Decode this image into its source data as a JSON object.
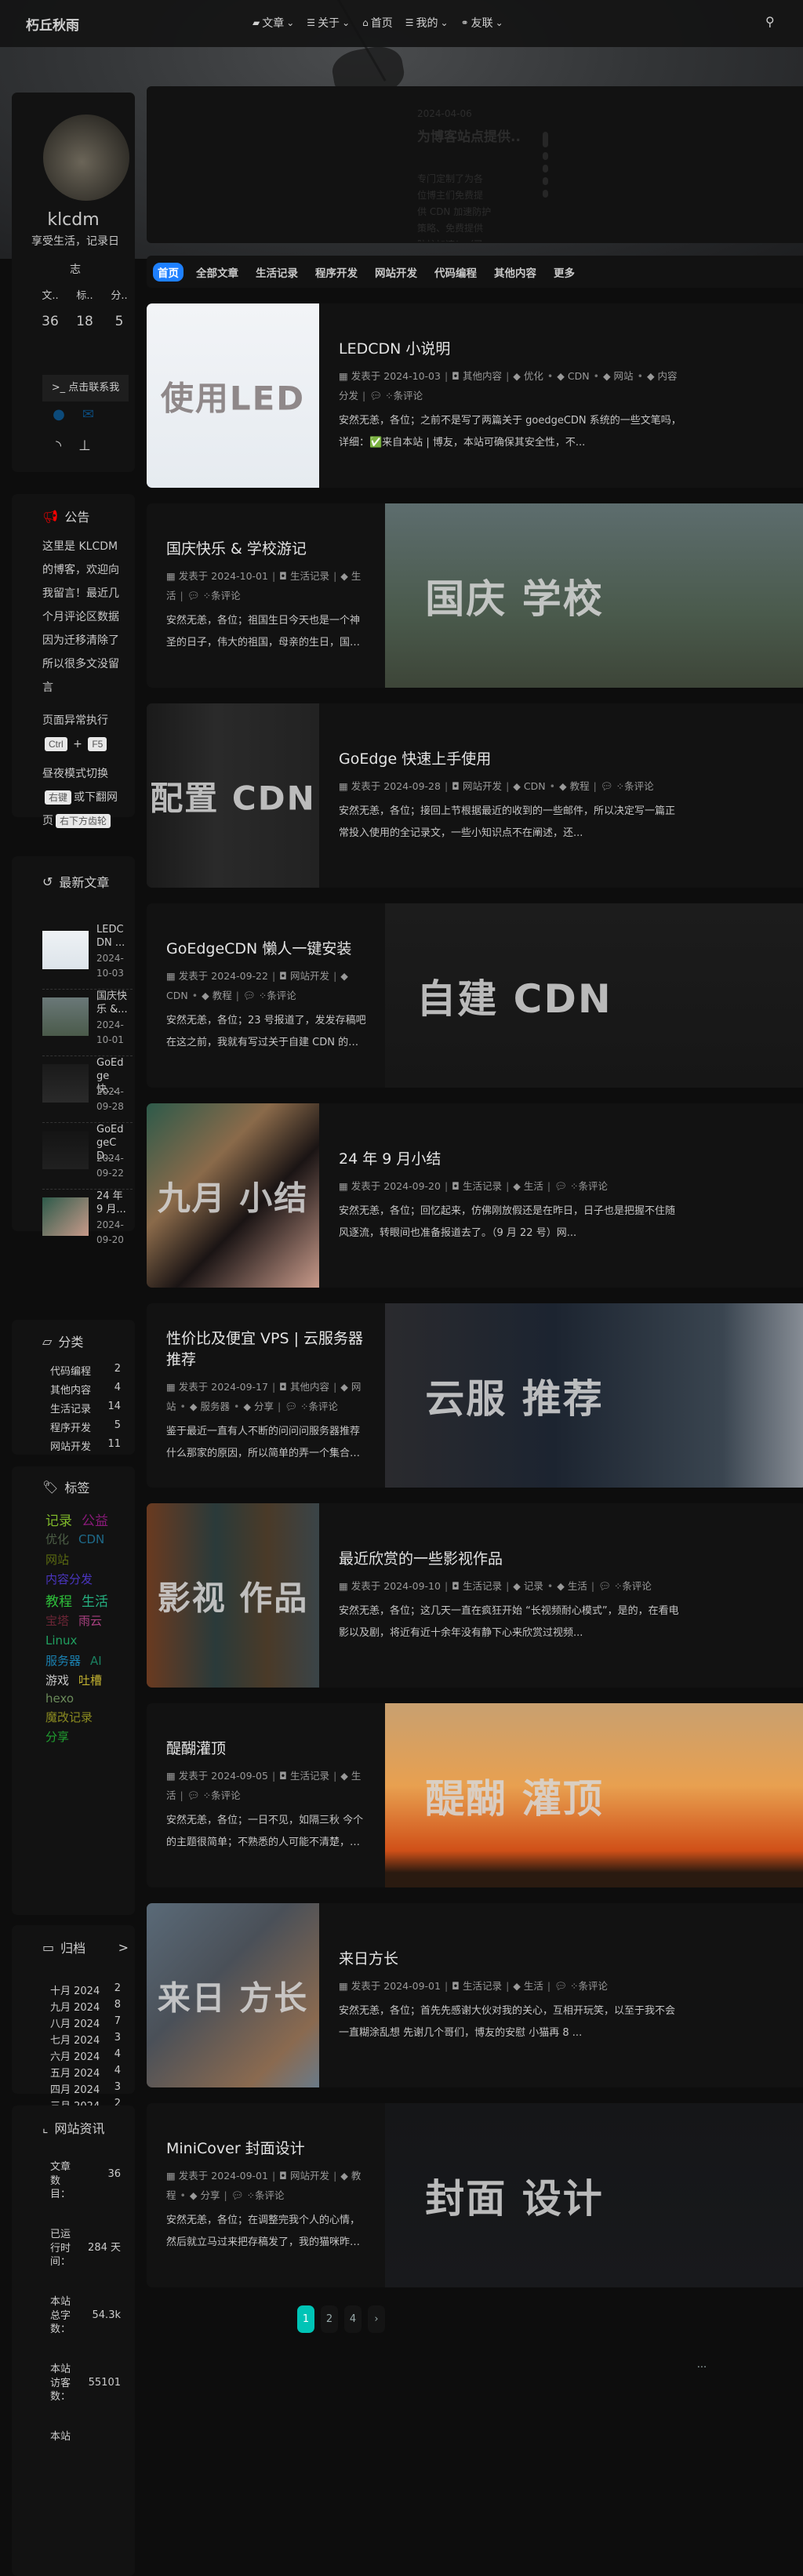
{
  "header": {
    "logo": "朽丘秋雨",
    "menu": [
      {
        "icon": "folder-icon",
        "glyph": "▰",
        "label": "文章",
        "dropdown": true
      },
      {
        "icon": "list-icon",
        "glyph": "☰",
        "label": "关于",
        "dropdown": true
      },
      {
        "icon": "home-icon",
        "glyph": "⌂",
        "label": "首页",
        "dropdown": false
      },
      {
        "icon": "list-icon",
        "glyph": "☰",
        "label": "我的",
        "dropdown": true
      },
      {
        "icon": "link-icon",
        "glyph": "⚭",
        "label": "友联",
        "dropdown": true
      }
    ],
    "search_icon": "search-icon"
  },
  "profile": {
    "name": "klcdm",
    "description": "享受生活，记录日志",
    "stats": [
      {
        "label": "文..",
        "value": "36"
      },
      {
        "label": "标..",
        "value": "18"
      },
      {
        "label": "分..",
        "value": "5"
      }
    ],
    "contact_button": "点击联系我",
    "social_color": "#0c4a7a"
  },
  "notice": {
    "title": "公告",
    "icon_color": "#ff0000",
    "text": "这里是 KLCDM 的博客，欢迎向我留言！最近几个月评论区数据因为迁移清除了所以很多文没留言",
    "refresh_label": "页面异常执行",
    "key1": "Ctrl",
    "plus": "+",
    "key2": "F5",
    "mode_label": "昼夜模式切换",
    "key3": "右键",
    "mode_mid": "或下翻网页",
    "key4": "右下方齿轮"
  },
  "latest": {
    "title": "最新文章",
    "items": [
      {
        "title": "LEDCDN ...",
        "date": "2024-10-03"
      },
      {
        "title": "国庆快乐 &...",
        "date": "2024-10-01"
      },
      {
        "title": "GoEdge 快...",
        "date": "2024-09-28"
      },
      {
        "title": "GoEdgeCD...",
        "date": "2024-09-22"
      },
      {
        "title": "24 年 9 月...",
        "date": "2024-09-20"
      }
    ]
  },
  "categories": {
    "title": "分类",
    "items": [
      {
        "name": "代码编程",
        "count": "2"
      },
      {
        "name": "其他内容",
        "count": "4"
      },
      {
        "name": "生活记录",
        "count": "14"
      },
      {
        "name": "程序开发",
        "count": "5"
      },
      {
        "name": "网站开发",
        "count": "11"
      }
    ]
  },
  "tags": {
    "title": "标签",
    "rows": [
      [
        {
          "name": "记录",
          "color": "#7fb82a"
        },
        {
          "name": "公益",
          "color": "#8a1a7a"
        }
      ],
      [
        {
          "name": "优化",
          "color": "#4c5e45"
        },
        {
          "name": "CDN",
          "color": "#1e6a8a"
        }
      ],
      [
        {
          "name": "网站",
          "color": "#5a6a10"
        }
      ],
      [
        {
          "name": "内容分发",
          "color": "#4a35c0"
        }
      ],
      [
        {
          "name": "教程",
          "color": "#2ec03a"
        },
        {
          "name": "生活",
          "color": "#25b080"
        }
      ],
      [
        {
          "name": "宝塔",
          "color": "#6a2535"
        },
        {
          "name": "雨云",
          "color": "#a84080"
        }
      ],
      [
        {
          "name": "Linux",
          "color": "#20a060"
        }
      ],
      [
        {
          "name": "服务器",
          "color": "#1a80b0"
        },
        {
          "name": "AI",
          "color": "#1a8060"
        }
      ],
      [
        {
          "name": "游戏",
          "color": "#c8c8c8"
        },
        {
          "name": "吐槽",
          "color": "#c0b030"
        }
      ],
      [
        {
          "name": "hexo",
          "color": "#6a8a5a"
        }
      ],
      [
        {
          "name": "魔改记录",
          "color": "#8a8a20"
        }
      ],
      [
        {
          "name": "分享",
          "color": "#20a030"
        }
      ]
    ]
  },
  "archive": {
    "title": "归档",
    "more": ">",
    "items": [
      {
        "month": "十月 2024",
        "count": "2"
      },
      {
        "month": "九月 2024",
        "count": "8"
      },
      {
        "month": "八月 2024",
        "count": "7"
      },
      {
        "month": "七月 2024",
        "count": "3"
      },
      {
        "month": "六月 2024",
        "count": "4"
      },
      {
        "month": "五月 2024",
        "count": "4"
      },
      {
        "month": "四月 2024",
        "count": "3"
      },
      {
        "month": "三月 2024",
        "count": "2"
      }
    ]
  },
  "site_info": {
    "title": "网站资讯",
    "items": [
      {
        "label": "文章数目：",
        "value": "36"
      },
      {
        "label": "已运行时间：",
        "value": "284 天"
      },
      {
        "label": "本站总字数：",
        "value": "54.3k"
      },
      {
        "label": "本站访客数：",
        "value": "55101"
      },
      {
        "label": "本站",
        "value": ""
      }
    ]
  },
  "hero": {
    "date": "2024-04-06",
    "title": "为博客站点提供..",
    "text": "专门定制了为各位博主们免费提供 CDN 加速防护策略、免费提供防护加速！（已经修改策略，请知）"
  },
  "tabs": [
    {
      "label": "首页",
      "active": true
    },
    {
      "label": "全部文章"
    },
    {
      "label": "生活记录"
    },
    {
      "label": "程序开发"
    },
    {
      "label": "网站开发"
    },
    {
      "label": "代码编程"
    },
    {
      "label": "其他内容"
    },
    {
      "label": "更多"
    }
  ],
  "meta_labels": {
    "posted": "发表于",
    "comments": "条评论"
  },
  "posts": [
    {
      "title": "LEDCDN 小说明",
      "date": "2024-10-03",
      "category": "其他内容",
      "tags": [
        "优化",
        "CDN",
        "网站",
        "内容分发"
      ],
      "excerpt": "安然无恙，各位；之前不是写了两篇关于 goedgeCDN 系统的一些文笔吗，详细：✅来自本站 | 博友，本站可确保其安全性，不...",
      "cover_text": "使用LED",
      "cover_bg": "linear-gradient(180deg,#f2f4f7,#e6ebf0)",
      "cover_color": "rgba(120,110,110,.8)"
    },
    {
      "title": "国庆快乐 & 学校游记",
      "date": "2024-10-01",
      "category": "生活记录",
      "tags": [
        "生活"
      ],
      "excerpt": "安然无恙，各位；祖国生日今天也是一个神圣的日子，伟大的祖国，母亲的生日，国庆节。在这伟大的日子里，首先先祝贺我们...",
      "cover_text": "国庆  学校",
      "cover_bg": "linear-gradient(180deg,#5d6d6e,#4a5a4c 60%,#3d4538)"
    },
    {
      "title": "GoEdge 快速上手使用",
      "date": "2024-09-28",
      "category": "网站开发",
      "tags": [
        "CDN",
        "教程"
      ],
      "excerpt": "安然无恙，各位；接回上节根据最近的收到的一些邮件，所以决定写一篇正常投入使用的全记录文，一些小知识点不在阐述，还...",
      "cover_text": "配置 CDN",
      "cover_bg": "linear-gradient(90deg,#1a1a1a,#2a2a2a 40%,#222)"
    },
    {
      "title": "GoEdgeCDN 懒人一键安装",
      "date": "2024-09-22",
      "category": "网站开发",
      "tags": [
        "CDN",
        "教程"
      ],
      "excerpt": "安然无恙，各位；23 号报道了，发发存稿吧 在这之前，我就有写过关于自建 CDN 的一些教程，只不过当时使用的程序是 cdnfly...",
      "cover_text": "自建  CDN",
      "cover_bg": "linear-gradient(180deg,#1c1c1c,#161616)"
    },
    {
      "title": "24 年 9 月小结",
      "date": "2024-09-20",
      "category": "生活记录",
      "tags": [
        "生活"
      ],
      "excerpt": "安然无恙，各位；回忆起来，仿佛刚放假还是在昨日，日子也是把握不住随风逐流，转眼间也准备报道去了。（9 月 22 号）网...",
      "cover_text": "九月 小结",
      "cover_bg": "linear-gradient(135deg,#2d5a4a 0%,#8a6a4a 35%,#1a1414 60%,#c89a8a 100%)"
    },
    {
      "title": "性价比及便宜 VPS | 云服务器推荐",
      "date": "2024-09-17",
      "category": "其他内容",
      "tags": [
        "网站",
        "服务器",
        "分享"
      ],
      "excerpt": "鉴于最近一直有人不断的问问问服务器推荐什么那家的原因，所以简单的弄一个集合，供大家参考 当然，也是水一下 提醒：新用...",
      "cover_text": "云服  推荐",
      "cover_bg": "linear-gradient(90deg,#2a2a2e,#1c2430 40%,#3a4550 80%,#8a9098)"
    },
    {
      "title": "最近欣赏的一些影视作品",
      "date": "2024-09-10",
      "category": "生活记录",
      "tags": [
        "记录",
        "生活"
      ],
      "excerpt": "安然无恙，各位；这几天一直在疯狂开始 “长视频耐心模式”，是的，在看电影以及剧，将近有近十余年没有静下心来欣赏过视频...",
      "cover_text": "影视  作品",
      "cover_bg": "linear-gradient(90deg,#6a3a20,#2a3a3a 40%,#4a3a28 70%,#3a4448)"
    },
    {
      "title": "醍醐灌顶",
      "date": "2024-09-05",
      "category": "生活记录",
      "tags": [
        "生活"
      ],
      "excerpt": "安然无恙，各位；一日不见，如隔三秋 今个的主题很简单；不熟悉的人可能不清楚，我个人，是有时候比较浮躁的，但有时候又...",
      "cover_text": "醍醐  灌顶",
      "cover_bg": "linear-gradient(180deg,#c8a070 0%,#e8a050 45%,#d05018 80%,#2a1a10 92%)"
    },
    {
      "title": "来日方长",
      "date": "2024-09-01",
      "category": "生活记录",
      "tags": [
        "生活"
      ],
      "excerpt": "安然无恙，各位；首先先感谢大伙对我的关心，互相开玩笑，以至于我不会一直糊涂乱想 先谢几个哥们，博友的安慰 小猫再 8 ...",
      "cover_text": "来日 方长",
      "cover_bg": "linear-gradient(135deg,#5a6a78,#4a5058 40%,#8a6a50 80%,#6a7a88)"
    },
    {
      "title": "MiniCover 封面设计",
      "date": "2024-09-01",
      "category": "网站开发",
      "tags": [
        "教程",
        "分享"
      ],
      "excerpt": "安然无恙，各位；在调整完我个人的心情，然后就立马过来把存稿发了，我的猫咪昨天中午去喵星了 简单介绍一下老哥的项目...",
      "cover_text": "封面 设计",
      "cover_bg": "linear-gradient(180deg,#151618,#18191c)"
    }
  ],
  "pagination": {
    "pages": [
      "1",
      "2",
      "...",
      "4"
    ],
    "current": "1",
    "next": "›"
  }
}
